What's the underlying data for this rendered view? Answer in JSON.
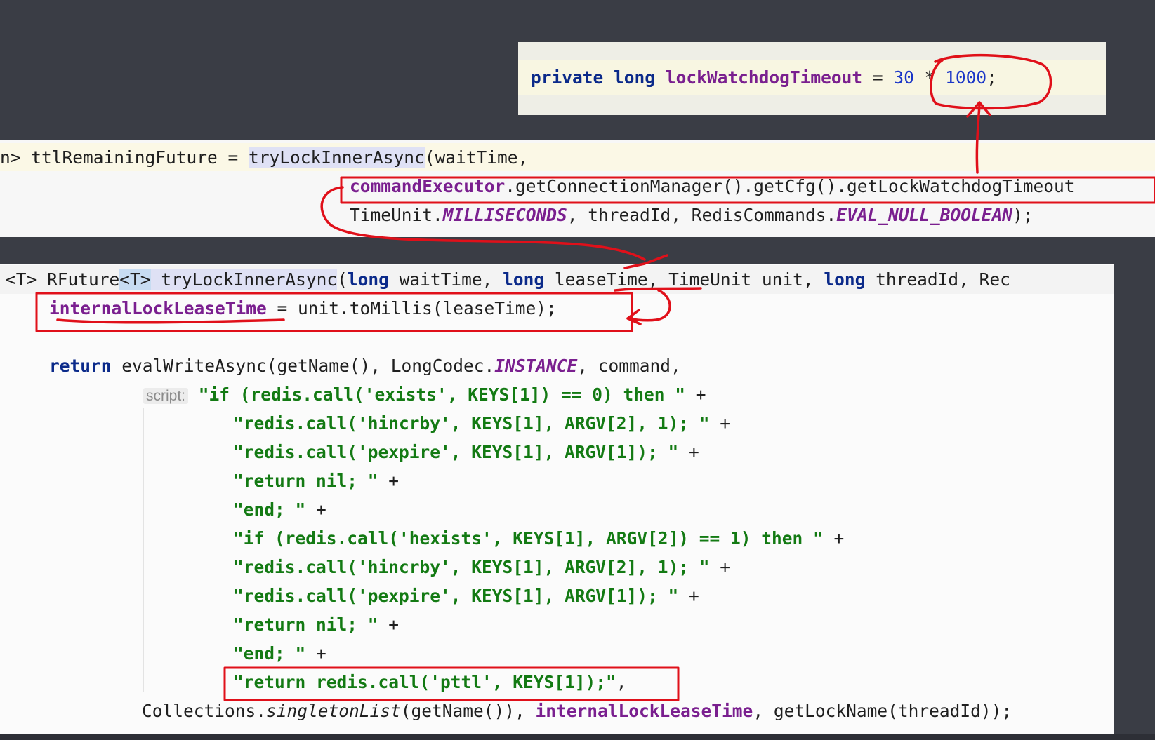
{
  "top_panel": {
    "line": {
      "kw1": "private",
      "kw2": "long",
      "name": "lockWatchdogTimeout",
      "eq": " = ",
      "n1": "30",
      "op": " * ",
      "n2": "1000",
      "semi": ";"
    }
  },
  "mid_panel": {
    "l1": {
      "a": "n> ttlRemainingFuture = ",
      "method": "tryLockInnerAsync",
      "b": "(waitTime,"
    },
    "l2": {
      "a": "commandExecutor",
      "b": ".getConnectionManager().getCfg().getLockWatchdogTimeout"
    },
    "l3": {
      "a": "TimeUnit.",
      "b": "MILLISECONDS",
      "c": ", threadId, RedisCommands.",
      "d": "EVAL_NULL_BOOLEAN",
      "e": ");"
    }
  },
  "main_panel": {
    "sig": {
      "a": "<T> RFuture",
      "t1": "<",
      "t2": "T",
      "t3": ">",
      "method": " tryLockInnerAsync",
      "b": "(",
      "kw1": "long",
      "c": " waitTime, ",
      "kw2": "long",
      "d": " leaseTime, TimeUnit unit, ",
      "kw3": "long",
      "e": " threadId, Rec"
    },
    "assign": {
      "field": "internalLockLeaseTime",
      "rest": " = unit.toMillis(leaseTime);"
    },
    "ret": {
      "kw": "return",
      "a": " evalWriteAsync(getName(), LongCodec.",
      "b": "INSTANCE",
      "c": ", command,"
    },
    "param_hint": "script:",
    "script": [
      {
        "s": "\"if (redis.call('exists', KEYS[1]) == 0) then \"",
        "t": " +"
      },
      {
        "s": "\"redis.call('hincrby', KEYS[1], ARGV[2], 1); \"",
        "t": " +"
      },
      {
        "s": "\"redis.call('pexpire', KEYS[1], ARGV[1]); \"",
        "t": " +"
      },
      {
        "s": "\"return nil; \"",
        "t": " +"
      },
      {
        "s": "\"end; \"",
        "t": " +"
      },
      {
        "s": "\"if (redis.call('hexists', KEYS[1], ARGV[2]) == 1) then \"",
        "t": " +"
      },
      {
        "s": "\"redis.call('hincrby', KEYS[1], ARGV[2], 1); \"",
        "t": " +"
      },
      {
        "s": "\"redis.call('pexpire', KEYS[1], ARGV[1]); \"",
        "t": " +"
      },
      {
        "s": "\"return nil; \"",
        "t": " +"
      },
      {
        "s": "\"end; \"",
        "t": " +"
      },
      {
        "s": "\"return redis.call('pttl', KEYS[1]);\"",
        "t": ","
      }
    ],
    "last": {
      "a": "Collections.",
      "b": "singletonList",
      "c": "(getName()), ",
      "d": "internalLockLeaseTime",
      "e": ", getLockName(threadId));"
    }
  },
  "colors": {
    "background": "#3a3d45",
    "keyword": "#0b2a8a",
    "field": "#7a1f8f",
    "string": "#137a13",
    "number": "#1a36c7",
    "annotation": "#e0101a"
  }
}
